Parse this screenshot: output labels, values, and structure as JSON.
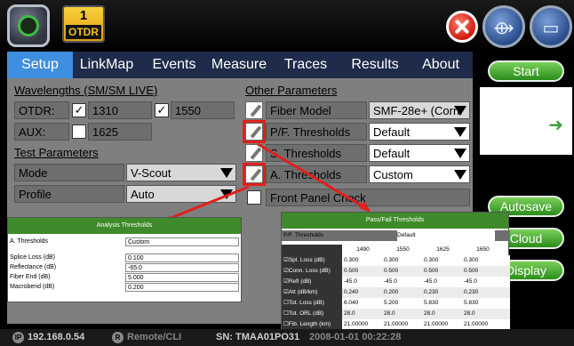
{
  "header": {
    "badge_number": "1",
    "badge_label": "OTDR",
    "connect_icon": "connection-icon",
    "folder_icon": "folder-icon"
  },
  "tabs": [
    "Setup",
    "LinkMap",
    "Events",
    "Measure",
    "Traces",
    "Results",
    "About"
  ],
  "wavelengths": {
    "title": "Wavelengths (SM/SM LIVE)",
    "otdr_label": "OTDR:",
    "w1": "1310",
    "w2": "1550",
    "aux_label": "AUX:",
    "aux": "1625"
  },
  "test_params": {
    "title": "Test Parameters",
    "mode_label": "Mode",
    "mode_value": "V-Scout",
    "profile_label": "Profile",
    "profile_value": "Auto"
  },
  "other_params": {
    "title": "Other Parameters",
    "fiber_model_label": "Fiber Model",
    "fiber_model_value": "SMF-28e+ (Corni",
    "pf_label": "P/F. Thresholds",
    "pf_value": "Default",
    "s_label": "S. Thresholds",
    "s_value": "Default",
    "a_label": "A. Thresholds",
    "a_value": "Custom",
    "front_panel": "Front Panel Check"
  },
  "side": {
    "start": "Start",
    "autosave": "Autosave",
    "cloud": "Cloud",
    "display": "Display"
  },
  "analysis": {
    "title": "Analysis Thresholds",
    "a_label": "A. Thresholds",
    "a_value": "Custom",
    "rows": [
      {
        "label": "Splice Loss (dB)",
        "value": "0.100"
      },
      {
        "label": "Reflectance (dB)",
        "value": "-65.0"
      },
      {
        "label": "Fiber End (dB)",
        "value": "5.000"
      },
      {
        "label": "Macrobend (dB)",
        "value": "0.200"
      }
    ]
  },
  "passfail": {
    "title": "Pass/Fail Thresholds",
    "pf_label": "P/F. Thresholds",
    "pf_value": "Default",
    "columns": [
      "1490",
      "1550",
      "1625",
      "1650"
    ],
    "rows": [
      {
        "label": "☑Spl. Loss (dB)",
        "vals": [
          "0.300",
          "0.300",
          "0.300",
          "0.300"
        ]
      },
      {
        "label": "☑Conn. Loss (dB)",
        "vals": [
          "0.500",
          "0.500",
          "0.500",
          "0.500"
        ]
      },
      {
        "label": "☑Refl (dB)",
        "vals": [
          "-45.0",
          "-45.0",
          "-45.0",
          "-45.0"
        ]
      },
      {
        "label": "☑Att (dB/km)",
        "vals": [
          "0.240",
          "0.200",
          "0.230",
          "0.230"
        ]
      },
      {
        "label": "☐Tot. Loss (dB)",
        "vals": [
          "6.040",
          "5.200",
          "5.830",
          "5.830"
        ]
      },
      {
        "label": "☐Tot. ORL (dB)",
        "vals": [
          "28.0",
          "28.0",
          "28.0",
          "28.0"
        ]
      },
      {
        "label": "☐Fib. Length (km)",
        "vals": [
          "21.00000",
          "21.00000",
          "21.00000",
          "21.00000"
        ]
      }
    ]
  },
  "status": {
    "ip": "192.168.0.54",
    "remote": "Remote/CLI",
    "sn": "SN: TMAA01PO31",
    "date": "2008-01-01 00:22:28"
  }
}
